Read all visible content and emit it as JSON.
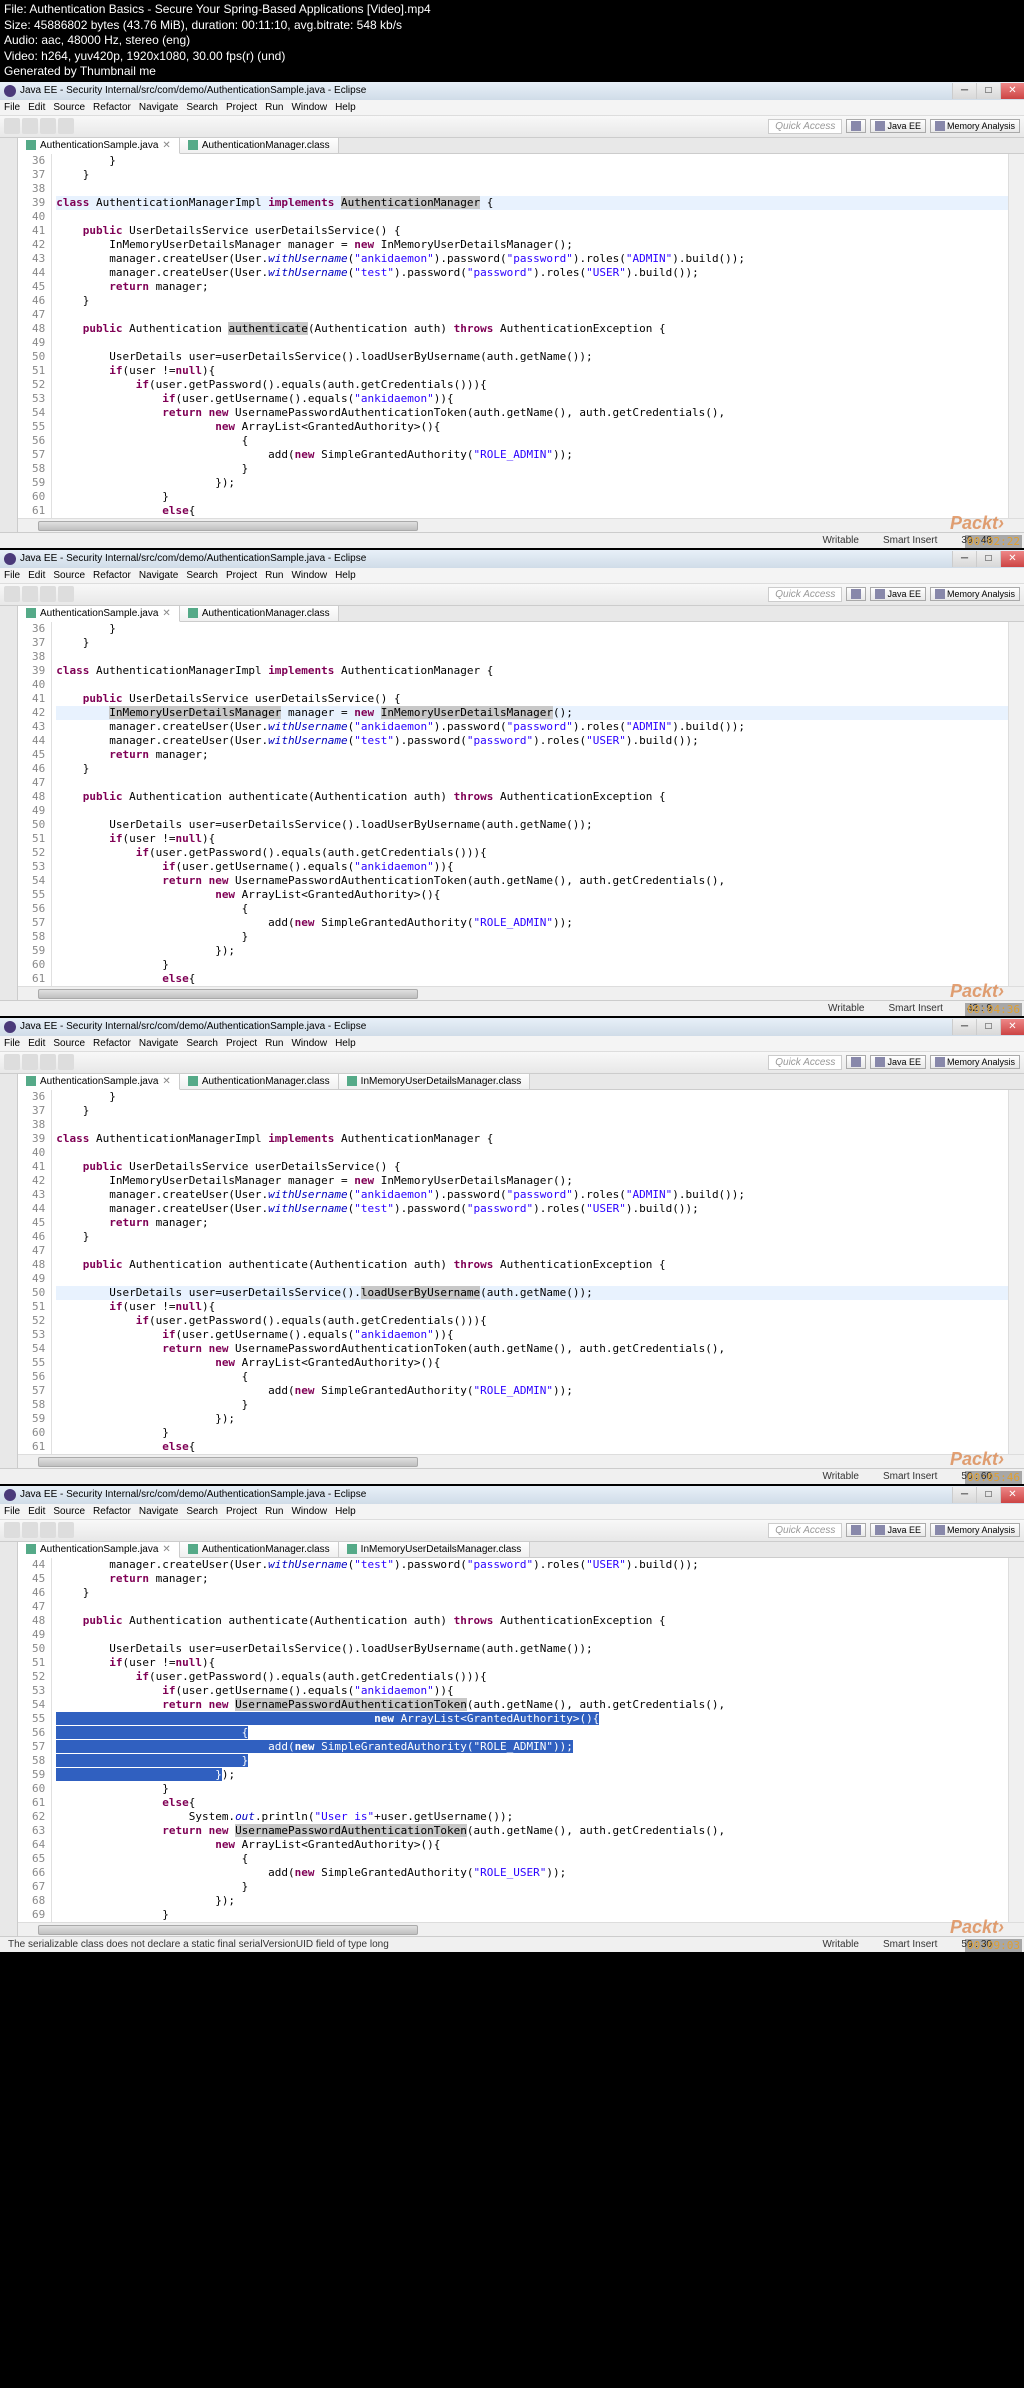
{
  "header": {
    "file": "File: Authentication Basics - Secure Your Spring-Based Applications [Video].mp4",
    "size": "Size: 45886802 bytes (43.76 MiB), duration: 00:11:10, avg.bitrate: 548 kb/s",
    "audio": "Audio: aac, 48000 Hz, stereo (eng)",
    "video": "Video: h264, yuv420p, 1920x1080, 30.00 fps(r) (und)",
    "generated": "Generated by Thumbnail me"
  },
  "eclipse": {
    "title": "Java EE - Security Internal/src/com/demo/AuthenticationSample.java - Eclipse",
    "menus": [
      "File",
      "Edit",
      "Source",
      "Refactor",
      "Navigate",
      "Search",
      "Project",
      "Run",
      "Window",
      "Help"
    ],
    "quickAccess": "Quick Access",
    "perspectives": [
      "Java EE",
      "Memory Analysis"
    ],
    "tabs": {
      "main": "AuthenticationSample.java",
      "t2": "AuthenticationManager.class",
      "t3": "InMemoryUserDetailsManager.class"
    },
    "status": {
      "writable": "Writable",
      "insert": "Smart Insert"
    }
  },
  "code": {
    "l36": "        }",
    "l37": "    }",
    "l38": "",
    "l39a": "class",
    "l39b": " AuthenticationManagerImpl ",
    "l39c": "implements",
    "l39d": " AuthenticationManager {",
    "l39hl": "AuthenticationManager",
    "l40": "",
    "l41a": "    public",
    "l41b": " UserDetailsService userDetailsService() {",
    "l42a": "        InMemoryUserDetailsManager manager = ",
    "l42b": "new",
    "l42c": " InMemoryUserDetailsManager();",
    "l43a": "        manager.createUser(User.",
    "l43b": "withUsername",
    "l43c": "(",
    "l43d": "\"ankidaemon\"",
    "l43e": ").password(",
    "l43f": "\"password\"",
    "l43g": ").roles(",
    "l43h": "\"ADMIN\"",
    "l43i": ").build());",
    "l44a": "        manager.createUser(User.",
    "l44b": "withUsername",
    "l44c": "(",
    "l44d": "\"test\"",
    "l44e": ").password(",
    "l44f": "\"password\"",
    "l44g": ").roles(",
    "l44h": "\"USER\"",
    "l44i": ").build());",
    "l45a": "        return",
    "l45b": " manager;",
    "l46": "    }",
    "l47": "",
    "l48a": "    public",
    "l48b": " Authentication ",
    "l48c": "authenticate",
    "l48d": "(Authentication auth) ",
    "l48e": "throws",
    "l48f": " AuthenticationException {",
    "l49": "",
    "l50a": "        UserDetails user=userDetailsService().loadUserByUsername(auth.getName());",
    "l50hl": "loadUserByUsername",
    "l51a": "        if",
    "l51b": "(user !=",
    "l51c": "null",
    "l51d": "){",
    "l52a": "            if",
    "l52b": "(user.getPassword().equals(auth.getCredentials())){",
    "l53a": "                if",
    "l53b": "(user.getUsername().equals(",
    "l53c": "\"ankidaemon\"",
    "l53d": ")){",
    "l54a": "                return new",
    "l54b": " UsernamePasswordAuthenticationToken(auth.getName(), auth.getCredentials(),",
    "l54hl": "UsernamePasswordAuthenticationToken",
    "l55a": "                        new",
    "l55b": " ArrayList<GrantedAuthority>(){",
    "l56": "                            {",
    "l57a": "                                add(",
    "l57b": "new",
    "l57c": " SimpleGrantedAuthority(",
    "l57d": "\"ROLE_ADMIN\"",
    "l57e": "));",
    "l58": "                            }",
    "l59": "                        });",
    "l60": "                }",
    "l61a": "                else",
    "l61b": "{",
    "l62a": "                    System.",
    "l62b": "out",
    "l62c": ".println(",
    "l62d": "\"User is\"",
    "l62e": "+user.getUsername());",
    "l63a": "                return new",
    "l63b": " ",
    "l64a": "                        new",
    "l64b": " ArrayList<GrantedAuthority>(){",
    "l65": "                            {",
    "l66a": "                                add(",
    "l66b": "new",
    "l66c": " SimpleGrantedAuthority(",
    "l66d": "\"ROLE_USER\"",
    "l66e": "));",
    "l67": "                            }",
    "l68": "                        });",
    "l69": "                }"
  },
  "frames": {
    "f1": {
      "cursor": "39 : 48",
      "timestamp": "00:02:22"
    },
    "f2": {
      "cursor": "42 : 9",
      "timestamp": "00:04:36"
    },
    "f3": {
      "cursor": "50 : 60",
      "timestamp": "00:05:46"
    },
    "f4": {
      "cursor": "59 : 30",
      "timestamp": "00:09:03"
    }
  },
  "problemMsg": "The serializable class  does not declare a static final serialVersionUID field of type long"
}
